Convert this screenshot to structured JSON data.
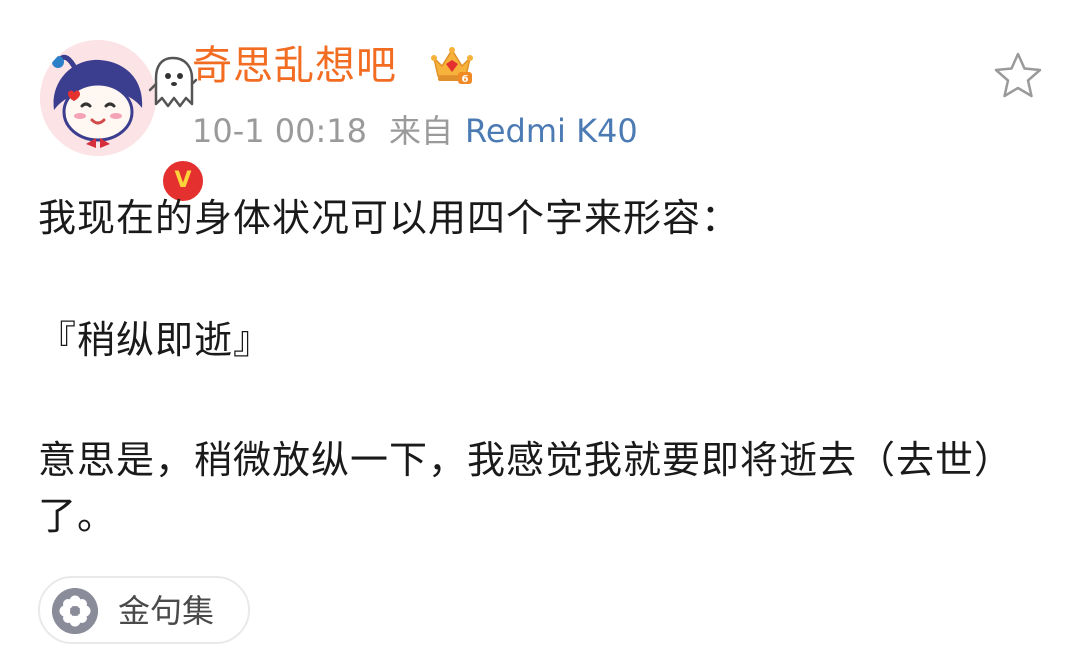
{
  "post": {
    "author": {
      "name": "奇思乱想吧",
      "verified_badge": "V",
      "membership_level": "6"
    },
    "meta": {
      "time": "10-1 00:18",
      "from_label": "来自",
      "device": "Redmi K40"
    },
    "content": {
      "paragraph_1": "我现在的身体状况可以用四个字来形容：",
      "paragraph_2": "『稍纵即逝』",
      "paragraph_3": "意思是，稍微放纵一下，我感觉我就要即将逝去（去世）了。"
    },
    "tag": {
      "label": "金句集",
      "icon": "flower-icon"
    },
    "actions": {
      "favorite_icon": "star-icon"
    }
  },
  "colors": {
    "author_name": "#f26c22",
    "meta_gray": "#9a9a9a",
    "device_link": "#4c7bb4",
    "verified_red": "#e4312f",
    "text": "#1a1a1a"
  }
}
